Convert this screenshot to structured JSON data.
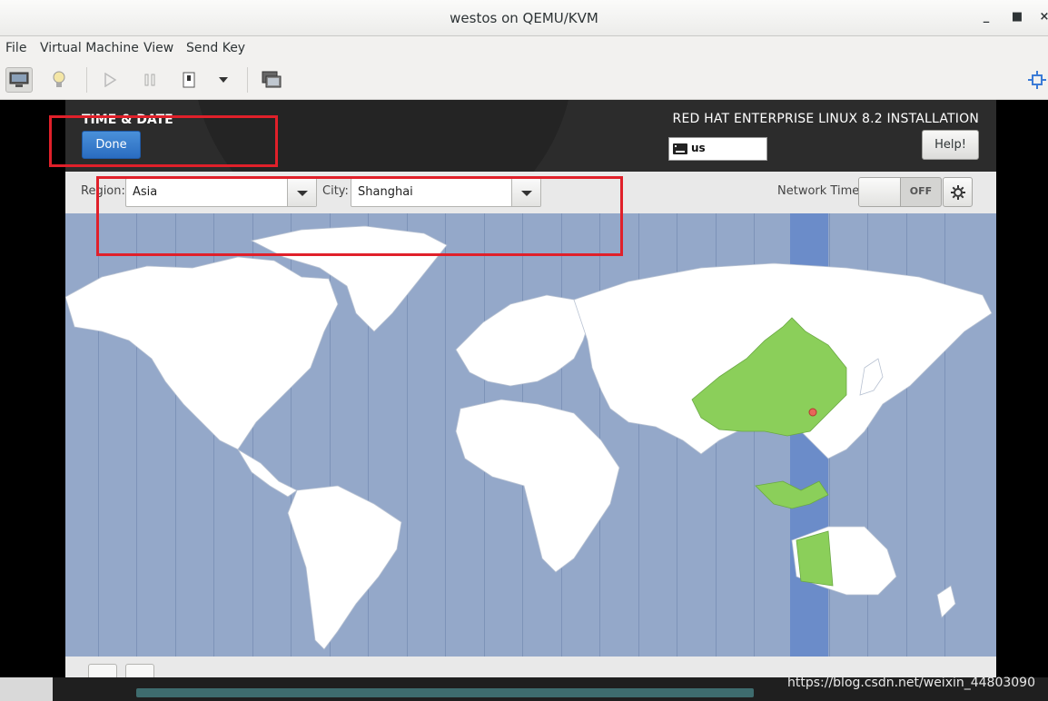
{
  "window": {
    "title": "westos on QEMU/KVM"
  },
  "menu": {
    "items": [
      "File",
      "Virtual Machine",
      "View",
      "Send Key"
    ]
  },
  "spoke": {
    "title": "TIME & DATE",
    "done_label": "Done",
    "product_title": "RED HAT ENTERPRISE LINUX 8.2 INSTALLATION",
    "keyboard_layout": "us",
    "help_label": "Help!"
  },
  "filters": {
    "region_label": "Region:",
    "region_value": "Asia",
    "city_label": "City:",
    "city_value": "Shanghai",
    "network_time_label": "Network Time",
    "network_time_state": "OFF"
  },
  "map": {
    "selected_timezone_color": "#6b8cc9",
    "selected_region_color": "#8bcf5a",
    "ocean_color": "#94a8c9",
    "land_color": "#ffffff",
    "selected_city_marker": "Shanghai"
  },
  "annotations": {
    "highlight_color": "#e0202a"
  },
  "watermark": "https://blog.csdn.net/weixin_44803090"
}
